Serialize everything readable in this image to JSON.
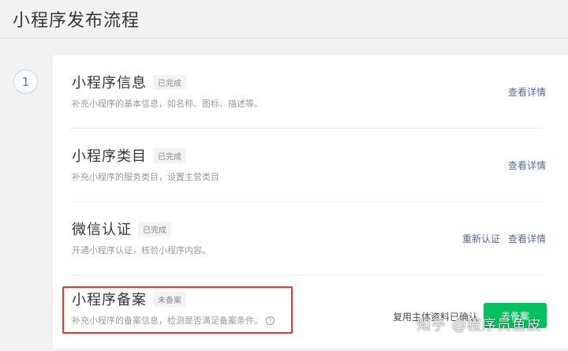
{
  "page": {
    "title": "小程序发布流程"
  },
  "step": {
    "number": "1"
  },
  "rows": [
    {
      "name": "小程序信息",
      "status": "已完成",
      "description": "补充小程序的基本信息，如名称、图标、描述等。",
      "actions": [
        "查看详情"
      ]
    },
    {
      "name": "小程序类目",
      "status": "已完成",
      "description": "补充小程序的服务类目，设置主营类目",
      "actions": [
        "查看详情"
      ]
    },
    {
      "name": "微信认证",
      "status": "已完成",
      "description": "开通小程序认证，核验小程序内容。",
      "actions": [
        "重新认证",
        "查看详情"
      ]
    },
    {
      "name": "小程序备案",
      "status": "未备案",
      "description": "补充小程序的备案信息，检测是否满足备案条件。",
      "help_icon": "question-circle-icon",
      "approval_note": "复用主体资料已确认",
      "primary_button": "去备案"
    }
  ],
  "watermark": "知乎 @程序员鱼皮",
  "colors": {
    "link": "#576b95",
    "primary": "#07c160",
    "highlight": "#e0392f"
  }
}
